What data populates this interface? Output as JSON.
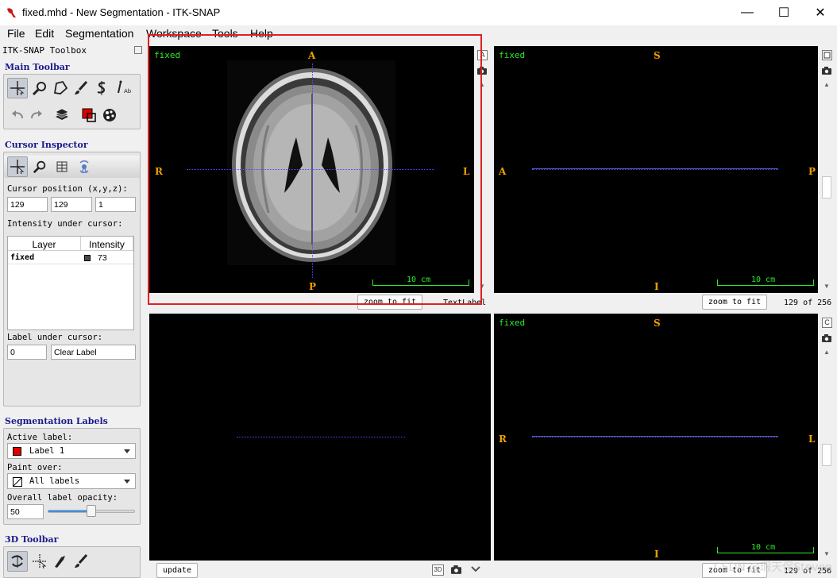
{
  "window": {
    "title": "fixed.mhd - New Segmentation - ITK-SNAP",
    "minimize": "—",
    "maximize": "☐",
    "close": "✕"
  },
  "menu": [
    "File",
    "Edit",
    "Segmentation",
    "Workspace",
    "Tools",
    "Help"
  ],
  "toolbox": {
    "title": "ITK-SNAP Toolbox",
    "main_toolbar_title": "Main Toolbar",
    "cursor_inspector_title": "Cursor Inspector",
    "cursor_position_label": "Cursor position (x,y,z):",
    "cursor_x": "129",
    "cursor_y": "129",
    "cursor_z": "1",
    "intensity_label": "Intensity under cursor:",
    "table_headers": [
      "Layer",
      "Intensity"
    ],
    "table_rows": [
      {
        "layer": "fixed",
        "intensity": "73"
      }
    ],
    "label_under_cursor_label": "Label under cursor:",
    "label_id": "0",
    "label_name": "Clear Label",
    "seg_labels_title": "Segmentation Labels",
    "active_label_label": "Active label:",
    "active_label_value": "Label 1",
    "paint_over_label": "Paint over:",
    "paint_over_value": "All labels",
    "opacity_label": "Overall label opacity:",
    "opacity_value": "50",
    "opacity_fraction": 0.5,
    "toolbar3d_title": "3D Toolbar"
  },
  "views": {
    "axial": {
      "layer_label": "fixed",
      "top": "A",
      "bottom": "P",
      "left": "R",
      "right": "L",
      "scale": "10 cm",
      "zoom_btn": "zoom to fit",
      "extra_text": "TextLabel",
      "corner_btn": "A"
    },
    "sagittal": {
      "layer_label": "fixed",
      "top": "S",
      "bottom": "I",
      "left": "A",
      "right": "P",
      "scale": "10 cm",
      "zoom_btn": "zoom to fit",
      "slice_text": "129 of 256"
    },
    "threed": {
      "update_btn": "update",
      "btn3d": "3D"
    },
    "coronal": {
      "layer_label": "fixed",
      "top": "S",
      "bottom": "I",
      "left": "R",
      "right": "L",
      "scale": "10 cm",
      "zoom_btn": "zoom to fit",
      "slice_text": "129 of 256",
      "corner_btn": "C"
    }
  },
  "watermark": "CSDN @瑕天保Steven",
  "colors": {
    "active_label": "#e00000",
    "orientation": "#f0a000",
    "overlay_text": "#2ee82e",
    "crosshair": "#4a4aff",
    "annotation_box": "#e02020"
  }
}
